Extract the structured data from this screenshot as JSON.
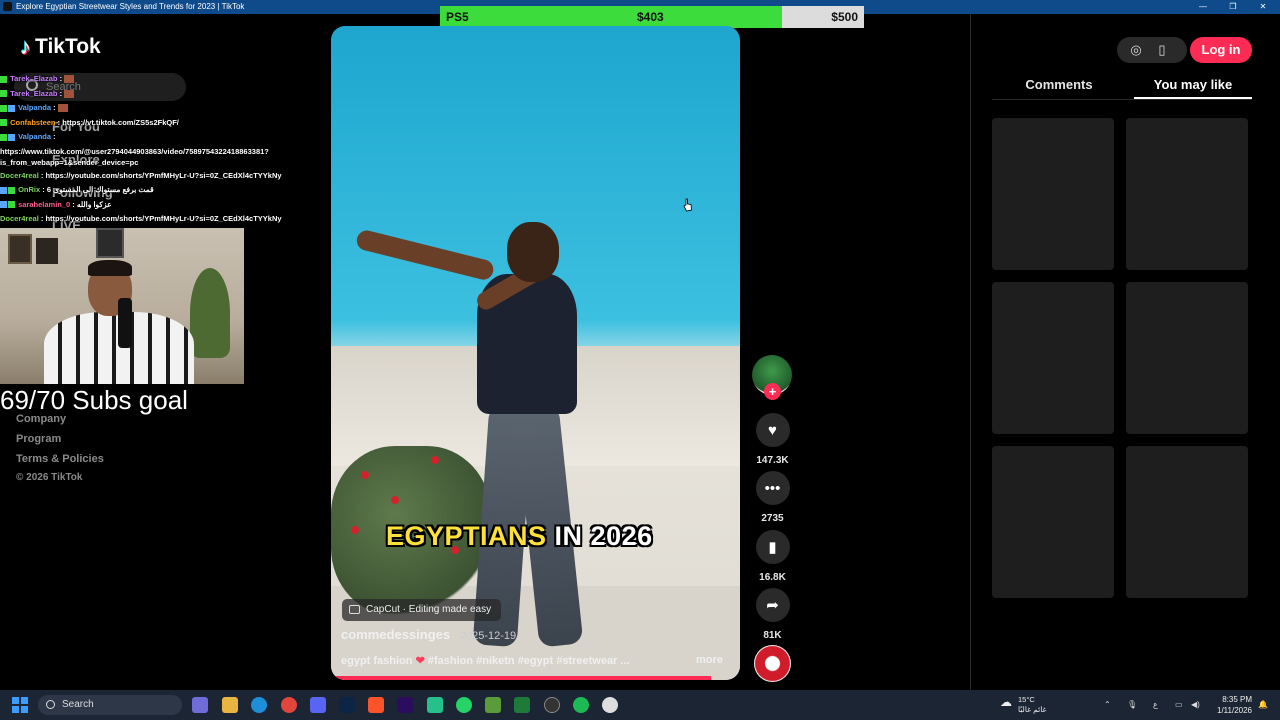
{
  "window": {
    "title": "Explore Egyptian Streetwear Styles and Trends for 2023 | TikTok",
    "controls": [
      "—",
      "❐",
      "✕"
    ]
  },
  "sidebar": {
    "logo": "TikTok",
    "search_placeholder": "Search",
    "nav": [
      "For You",
      "Explore",
      "Following",
      "LIVE"
    ],
    "footer": [
      "Company",
      "Program",
      "Terms & Policies",
      "© 2026 TikTok"
    ]
  },
  "stream_overlay": {
    "chat": [
      {
        "user": "Tarek_Elazab",
        "color": "#c77dff",
        "text": "",
        "emote": true
      },
      {
        "user": "Tarek_Elazab",
        "color": "#c77dff",
        "text": "",
        "emote": true
      },
      {
        "user": "Valpanda",
        "color": "#5aa6ff",
        "text": "",
        "emote": true
      },
      {
        "user": "Confabsteen",
        "color": "#ff9f1c",
        "text": "https://vt.tiktok.com/ZS5s2FkQF/",
        "emote": false
      },
      {
        "user": "Valpanda",
        "color": "#5aa6ff",
        "text": "",
        "emote": false
      },
      {
        "user": "",
        "color": "#ffffff",
        "text": "https://www.tiktok.com/@user2794044903863/video/7589754322418863381?is_from_webapp=1&sender_device=pc",
        "emote": false
      },
      {
        "user": "Docer4real",
        "color": "#7bd35a",
        "text": "https://youtube.com/shorts/YPmfMHyLr-U?si=0Z_CEdXl4cTYYkNy",
        "emote": false
      },
      {
        "user": "OnRix",
        "color": "#7bd35a",
        "text": "قمت برفع مستواك الى المستوى 6",
        "emote": false
      },
      {
        "user": "sarahelamin_0",
        "color": "#ff5c8a",
        "text": "عزكوا والله",
        "emote": false
      },
      {
        "user": "Docer4real",
        "color": "#7bd35a",
        "text": "https://youtube.com/shorts/YPmfMHyLr-U?si=0Z_CEdXl4cTYYkNy",
        "emote": false
      }
    ],
    "subs_goal": "69/70 Subs goal",
    "donation": {
      "label": "PS5",
      "current": "$403",
      "target": "$500",
      "progress": 0.806
    }
  },
  "video": {
    "caption_part1": "EGYPTIANS",
    "caption_part2": "IN 2026",
    "capcut": "CapCut · Editing made easy",
    "author": "commedessinges",
    "date": " · 2025-12-19",
    "description_start": "egypt fashion ",
    "description_rest": " #fashion #niketn #egypt #streetwear ...",
    "more": "more",
    "progress": 0.93
  },
  "actions": {
    "likes": "147.3K",
    "comments": "2735",
    "saves": "16.8K",
    "shares": "81K"
  },
  "header": {
    "login": "Log in"
  },
  "right_panel": {
    "tabs": [
      "Comments",
      "You may like"
    ],
    "active_tab": "You may like"
  },
  "taskbar": {
    "search": "Search",
    "weather_temp": "15°C",
    "weather_text": "غائم غالبًا",
    "time": "8:35 PM",
    "date": "1/11/2026",
    "lang": "ع"
  },
  "colors": {
    "accent": "#fe2c55",
    "donation_fill": "#3ddc3d",
    "caption_yellow": "#ffe13b"
  }
}
